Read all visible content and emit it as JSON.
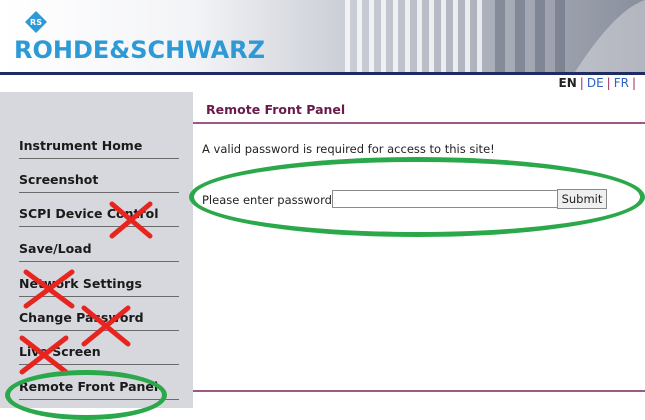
{
  "brand": {
    "name": "ROHDE&SCHWARZ",
    "logo_icon": "rs-diamond-logo-icon"
  },
  "languages": {
    "items": [
      "EN",
      "DE",
      "FR"
    ],
    "active": "EN"
  },
  "sidebar": {
    "items": [
      {
        "label": "Instrument Home",
        "crossed": false,
        "highlighted": false
      },
      {
        "label": "Screenshot",
        "crossed": false,
        "highlighted": false
      },
      {
        "label": "SCPI Device Control",
        "crossed": true,
        "highlighted": false
      },
      {
        "label": "Save/Load",
        "crossed": false,
        "highlighted": false
      },
      {
        "label": "Network Settings",
        "crossed": true,
        "highlighted": false
      },
      {
        "label": "Change Password",
        "crossed": true,
        "highlighted": false
      },
      {
        "label": "Live Screen",
        "crossed": true,
        "highlighted": false
      },
      {
        "label": "Remote Front Panel",
        "crossed": false,
        "highlighted": true
      }
    ]
  },
  "main": {
    "title": "Remote Front Panel",
    "message": "A valid password is required for access to this site!",
    "password_label": "Please enter password:",
    "password_value": "",
    "submit_label": "Submit"
  },
  "colors": {
    "brand_blue": "#2d9ad6",
    "header_rule": "#1f2c63",
    "title_color": "#6b1a4a",
    "sidebar_bg": "#d7d8de",
    "annotation_green": "#2aa84a",
    "annotation_red": "#e8241f"
  }
}
